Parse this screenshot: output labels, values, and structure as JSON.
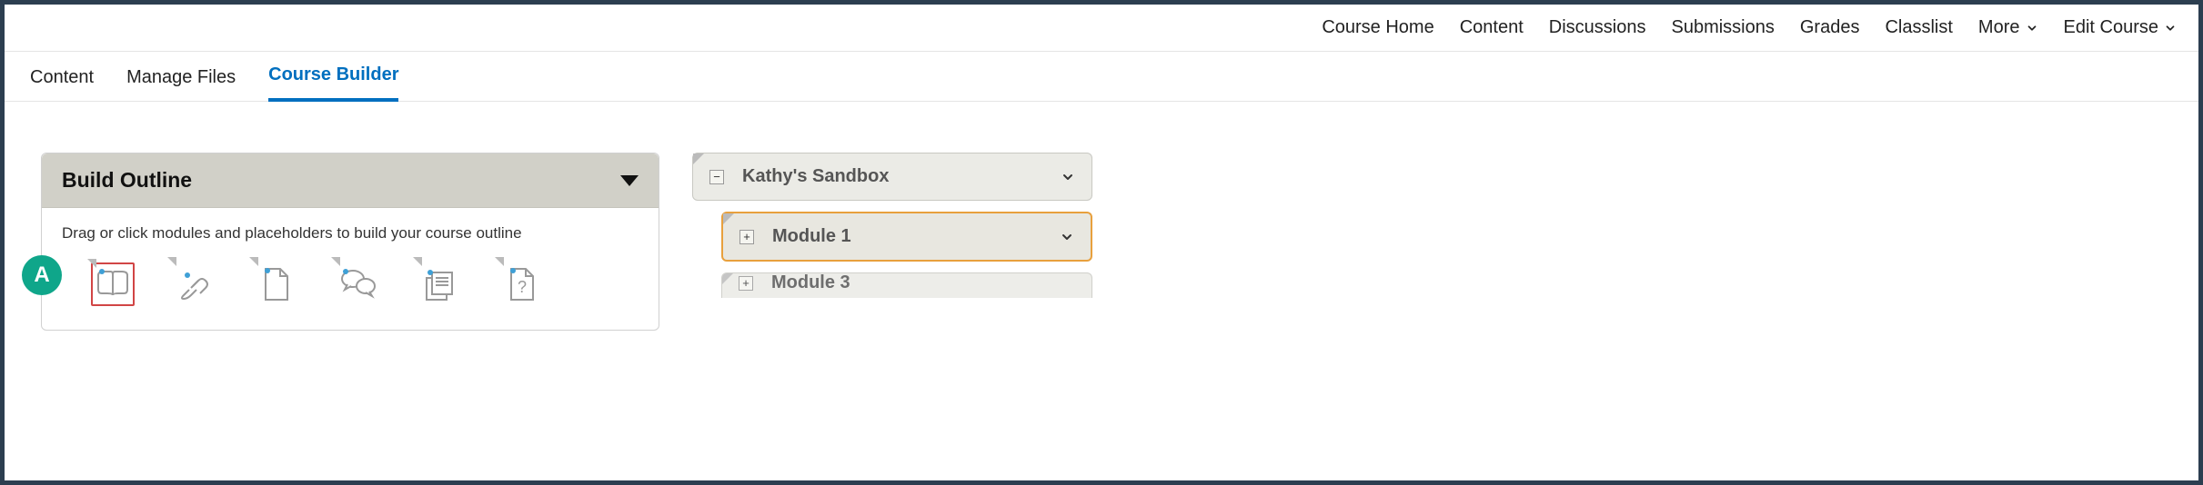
{
  "topnav": {
    "items": [
      {
        "label": "Course Home"
      },
      {
        "label": "Content"
      },
      {
        "label": "Discussions"
      },
      {
        "label": "Submissions"
      },
      {
        "label": "Grades"
      },
      {
        "label": "Classlist"
      }
    ],
    "more_label": "More",
    "edit_label": "Edit Course"
  },
  "subnav": {
    "items": [
      {
        "label": "Content",
        "active": false
      },
      {
        "label": "Manage Files",
        "active": false
      },
      {
        "label": "Course Builder",
        "active": true
      }
    ]
  },
  "build_panel": {
    "title": "Build Outline",
    "instruction": "Drag or click modules and placeholders to build your course outline",
    "tools": [
      {
        "name": "module-icon"
      },
      {
        "name": "link-icon"
      },
      {
        "name": "file-icon"
      },
      {
        "name": "discussion-icon"
      },
      {
        "name": "assignment-icon"
      },
      {
        "name": "quiz-icon"
      }
    ]
  },
  "annotation": {
    "letter": "A"
  },
  "tree": {
    "root": {
      "label": "Kathy's Sandbox",
      "expanded": true
    },
    "children": [
      {
        "label": "Module 1",
        "selected": true
      },
      {
        "label": "Module 3",
        "partial": true
      }
    ]
  }
}
